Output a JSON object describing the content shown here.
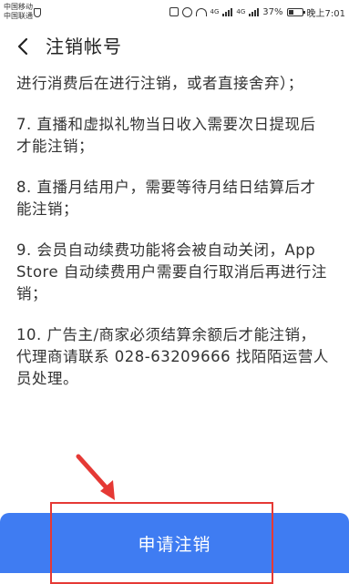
{
  "status_bar": {
    "carrier_1": "中国移动",
    "carrier_2": "中国联通",
    "network_label_1": "4G",
    "network_label_2": "4G",
    "battery_percent": "37%",
    "battery_level": 0.37,
    "time": "晚上7:01"
  },
  "header": {
    "back_icon": "chevron-left",
    "title": "注销帐号"
  },
  "content": {
    "paragraphs": [
      "进行消费后在进行注销，或者直接舍弃）；",
      "7. 直播和虚拟礼物当日收入需要次日提现后才能注销；",
      "8. 直播月结用户，需要等待月结日结算后才能注销；",
      "9. 会员自动续费功能将会被自动关闭，App Store 自动续费用户需要自行取消后再进行注销；",
      "10. 广告主/商家必须结算余额后才能注销，代理商请联系 028-63209666 找陌陌运营人员处理。"
    ]
  },
  "footer": {
    "apply_label": "申请注销",
    "button_color": "#3f7cf2"
  },
  "annotation": {
    "color": "#e53935"
  }
}
